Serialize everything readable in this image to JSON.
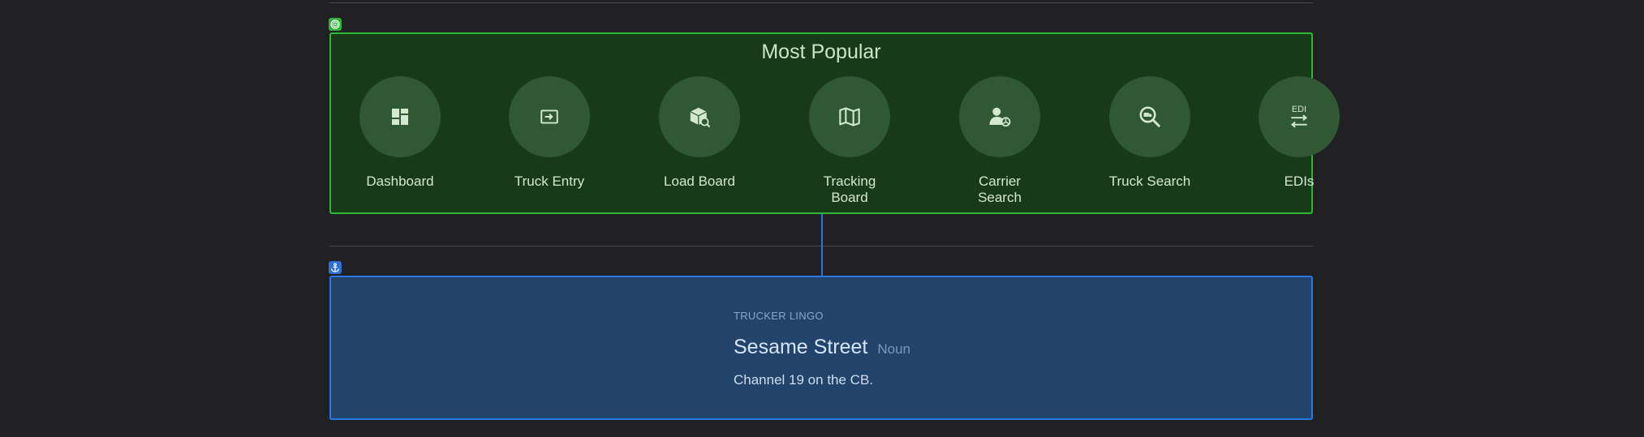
{
  "popular": {
    "title": "Most Popular",
    "items": [
      {
        "label": "Dashboard",
        "icon": "dashboard-icon"
      },
      {
        "label": "Truck Entry",
        "icon": "truck-entry-icon"
      },
      {
        "label": "Load Board",
        "icon": "load-board-icon"
      },
      {
        "label": "Tracking Board",
        "icon": "map-icon"
      },
      {
        "label": "Carrier Search",
        "icon": "carrier-search-icon"
      },
      {
        "label": "Truck Search",
        "icon": "truck-search-icon"
      },
      {
        "label": "EDIs",
        "icon": "edi-icon"
      }
    ]
  },
  "lingo": {
    "kicker": "TRUCKER LINGO",
    "word": "Sesame Street",
    "part_of_speech": "Noun",
    "definition": "Channel 19 on the CB."
  },
  "colors": {
    "popular_bg": "#183a18",
    "popular_border": "#2bb934",
    "lingo_bg": "#22446a",
    "lingo_border": "#2a78e6"
  },
  "icons": {
    "popular_tag": "target-icon",
    "lingo_tag": "anchor-icon"
  }
}
